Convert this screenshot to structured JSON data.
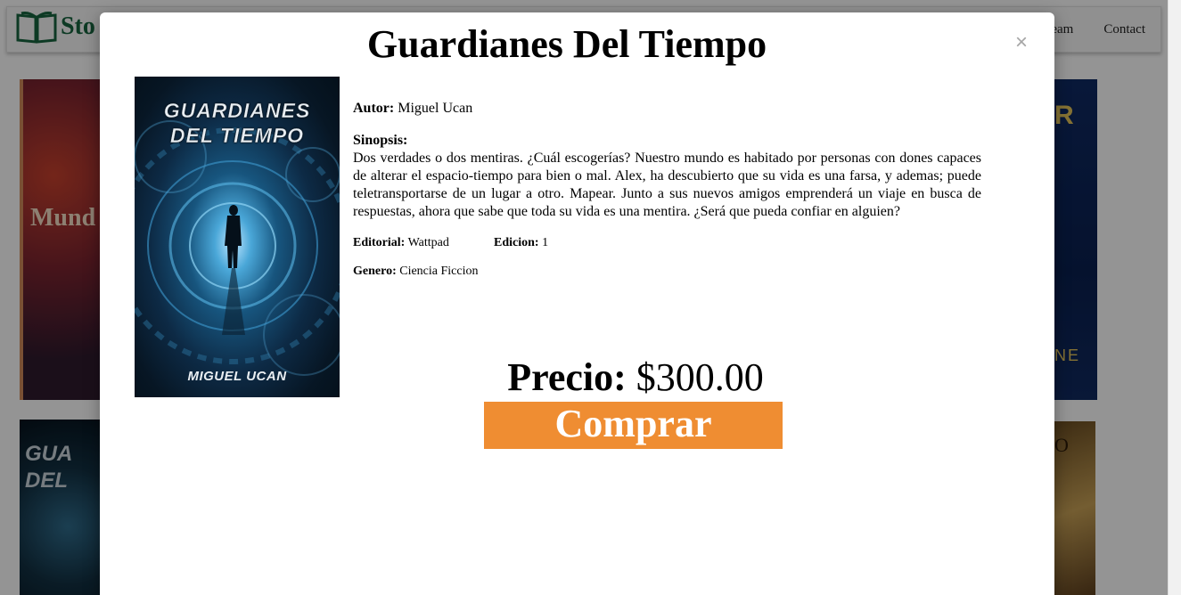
{
  "background": {
    "brand": {
      "name": "Sto",
      "icon": "open-book-icon"
    },
    "nav": [
      {
        "label": "eam"
      },
      {
        "label": "Contact"
      }
    ],
    "covers": {
      "red_word": "Mund",
      "blue_top": "R",
      "blue_bottom": "NE",
      "dark_title_1": "GUA",
      "dark_title_2": "DEL",
      "gold_text": "O"
    }
  },
  "modal": {
    "title": "Guardianes Del Tiempo",
    "close_icon": "close-icon",
    "cover": {
      "title_line1": "GUARDIANES",
      "title_line2": "DEL TIEMPO",
      "author": "MIGUEL UCAN"
    },
    "author_label": "Autor:",
    "author": "Miguel Ucan",
    "synopsis_label": "Sinopsis:",
    "synopsis": "Dos verdades o dos mentiras. ¿Cuál escogerías? Nuestro mundo es habitado por personas con dones capaces de alterar el espacio-tiempo para bien o mal. Alex, ha descubierto que su vida es una farsa, y ademas; puede teletransportarse de un lugar a otro. Mapear. Junto a sus nuevos amigos emprenderá un viaje en busca de respuestas, ahora que sabe que toda su vida es una mentira. ¿Será que pueda confiar en alguien?",
    "editorial_label": "Editorial:",
    "editorial": "Wattpad",
    "edition_label": "Edicion:",
    "edition": "1",
    "genre_label": "Genero:",
    "genre": "Ciencia Ficcion",
    "price_label": "Precio:",
    "price": "$300.00",
    "buy_label": "Comprar",
    "buy_color": "#ef8d32"
  }
}
